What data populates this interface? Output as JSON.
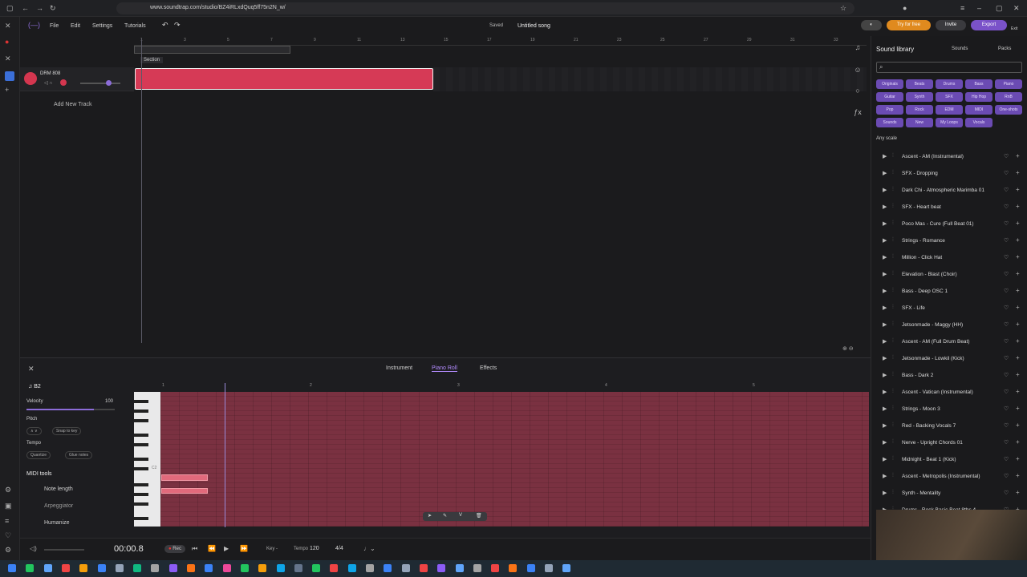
{
  "browser": {
    "url": "www.soundtrap.com/studio/BZ4iRLxdQuq5ff75n2N_w/"
  },
  "app": {
    "menu": [
      "File",
      "Edit",
      "Settings",
      "Tutorials"
    ],
    "saved": "Saved",
    "song_title": "Untitled song",
    "try_button": "Try for free",
    "invite_button": "Invite",
    "export_button": "Export",
    "exit_label": "Exit"
  },
  "timeline": {
    "ticks": [
      "1",
      "3",
      "5",
      "7",
      "9",
      "11",
      "13",
      "15",
      "17",
      "19",
      "21",
      "23",
      "25",
      "27",
      "29",
      "31",
      "33"
    ],
    "section_label": "Section"
  },
  "track": {
    "name": "DRM 808",
    "add_track": "Add New Track"
  },
  "editor": {
    "tabs": [
      "Instrument",
      "Piano Roll",
      "Effects"
    ],
    "note_name": "B2",
    "velocity_label": "Velocity",
    "velocity_value": "100",
    "velocity_level": 1.0,
    "pitch_label": "Pitch",
    "snap_to_key": "Snap to key",
    "tempo_label": "Tempo",
    "quantize": "Quantize",
    "glue_notes": "Glue notes",
    "midi_tools": "MIDI tools",
    "tools": [
      "Note length",
      "Arpeggiator",
      "Humanize"
    ],
    "ruler": [
      "1",
      "2",
      "3",
      "4",
      "5"
    ],
    "key_label": "C2"
  },
  "transport": {
    "time": "00:00.8",
    "rec": "Rec",
    "key": "Key -",
    "tempo_label": "Tempo",
    "tempo": "120",
    "signature": "4/4"
  },
  "library": {
    "title": "Sound library",
    "sounds_tab": "Sounds",
    "packs_tab": "Packs",
    "chips": [
      "Originals",
      "Beats",
      "Drums",
      "Bass",
      "Piano",
      "Guitar",
      "Synth",
      "SFX",
      "Hip Hop",
      "RnB",
      "Pop",
      "Rock",
      "EDM",
      "MIDI",
      "One-shots",
      "Sounds",
      "New",
      "My Loops",
      "Vocals"
    ],
    "scale": "Any scale",
    "items": [
      "Ascent - AM (Instrumental)",
      "SFX - Dropping",
      "Dark Chi - Atmospheric Marimba 01",
      "SFX - Heart beat",
      "Poco Mas - Cure (Full Beat 01)",
      "Strings - Romance",
      "Million - Click Hat",
      "Elevation - Blast (Choir)",
      "Bass - Deep OSC 1",
      "SFX - Life",
      "Jetsonmade - Maggy (HH)",
      "Ascent - AM (Full Drum Beat)",
      "Jetsonmade - Lowkil (Kick)",
      "Bass - Dark 2",
      "Ascent - Vatican (Instrumental)",
      "Strings - Moon 3",
      "Red - Backing Vocals 7",
      "Nerve - Upright Chords 01",
      "Midnight - Beat 1 (Kick)",
      "Ascent - Metropolis (Instrumental)",
      "Synth - Mentality",
      "Drums - Rock Basic Beat 8ths 4",
      "(Songsta..."
    ]
  }
}
